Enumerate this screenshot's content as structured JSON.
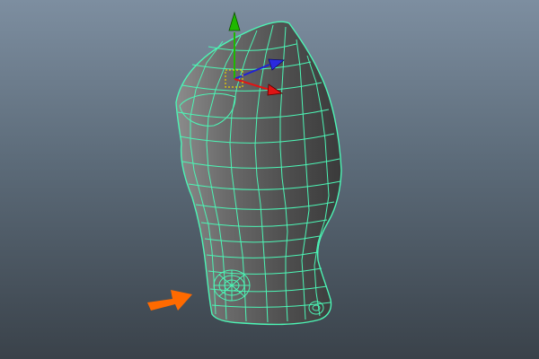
{
  "viewport": {
    "type": "3d-modeling-viewport",
    "background_top": "#7d8ea0",
    "background_bottom": "#3a424a"
  },
  "model": {
    "mesh": "torso-mesh",
    "shell_color": "#5b5b5b",
    "wireframe_color": "#4cf5b5"
  },
  "manipulator": {
    "tool": "move-tool",
    "y_axis_color": "#1fb800",
    "x_axis_color": "#e01414",
    "z_axis_color": "#1f1fd8",
    "center_handle_color": "#e8d100"
  },
  "annotation": {
    "pointer": "arrow-icon",
    "color": "#ff6a00",
    "points_to": "circular-hole-loop"
  }
}
